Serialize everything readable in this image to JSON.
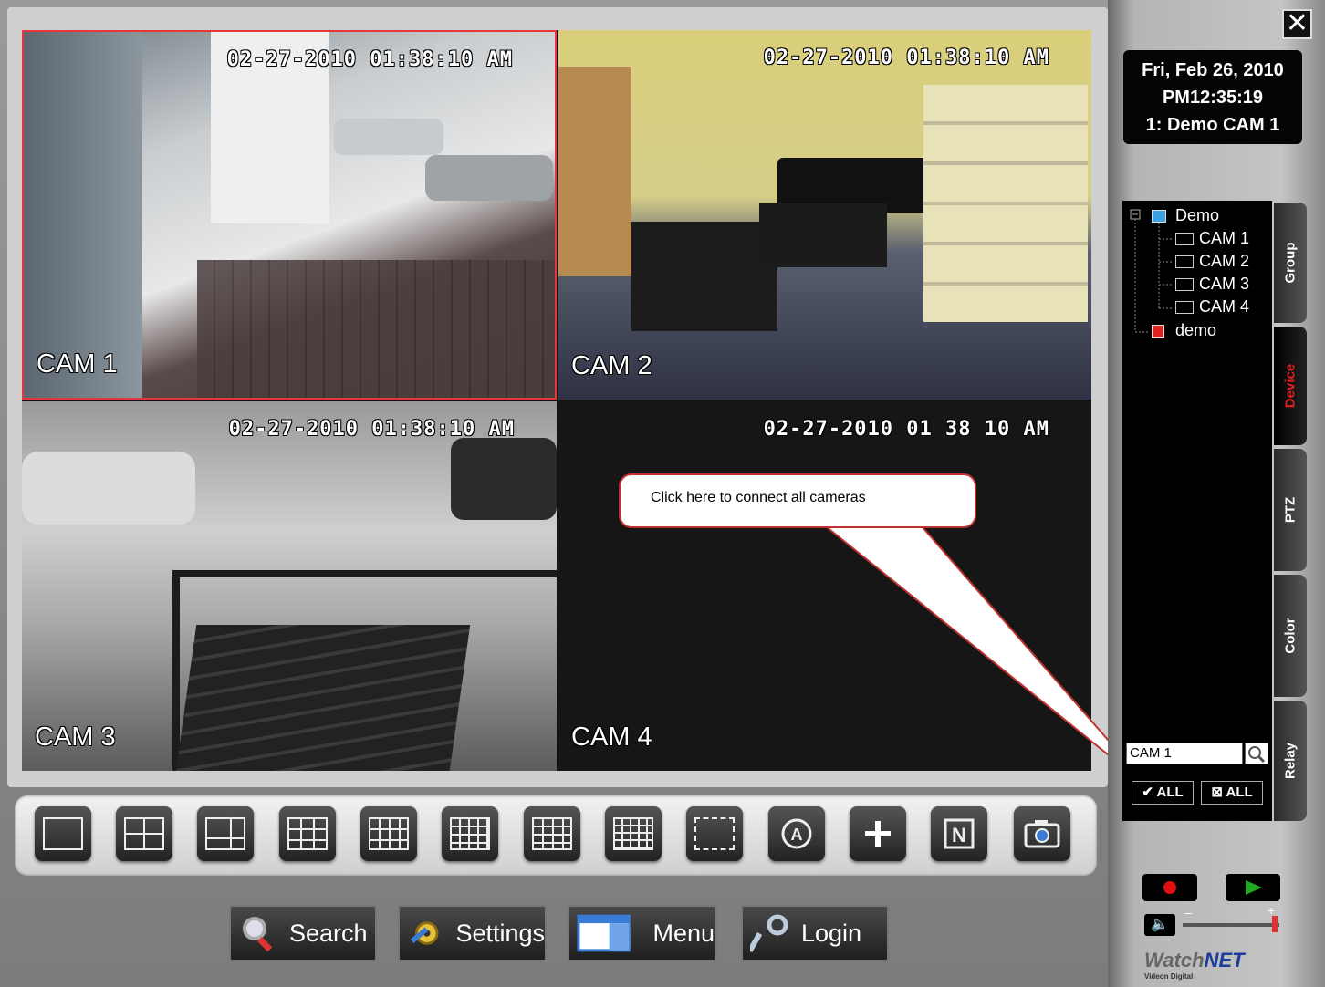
{
  "window": {
    "close_label": "✕"
  },
  "clock": {
    "date": "Fri, Feb 26, 2010",
    "time": "PM12:35:19",
    "camera": "1: Demo CAM 1"
  },
  "cameras": [
    {
      "label": "CAM 1",
      "timestamp": "02-27-2010 01:38:10 AM"
    },
    {
      "label": "CAM 2",
      "timestamp": "02-27-2010 01:38:10 AM"
    },
    {
      "label": "CAM 3",
      "timestamp": "02-27-2010 01:38:10 AM"
    },
    {
      "label": "CAM 4",
      "timestamp": "02-27-2010 01 38 10 AM"
    }
  ],
  "callout": {
    "text": "Click here to connect all cameras"
  },
  "tree": {
    "root": "Demo",
    "children": [
      "CAM 1",
      "CAM 2",
      "CAM 3",
      "CAM 4"
    ],
    "second_root": "demo"
  },
  "tabs": [
    "Group",
    "Device",
    "PTZ",
    "Color",
    "Relay"
  ],
  "active_tab": "Device",
  "search": {
    "value": "CAM 1"
  },
  "all_buttons": {
    "connect": "✔ ALL",
    "disconnect": "⊠ ALL"
  },
  "layout_buttons": [
    "1",
    "4",
    "6",
    "9",
    "10",
    "13",
    "16",
    "16b",
    "full",
    "auto",
    "add",
    "N",
    "snapshot"
  ],
  "bottom_buttons": {
    "search": "Search",
    "settings": "Settings",
    "menu": "Menu",
    "login": "Login"
  },
  "volume": {
    "minus": "–",
    "plus": "+",
    "level": 1.0
  },
  "logo": {
    "brand_a": "Watch",
    "brand_b": "NET",
    "sub": "Videon Digital"
  },
  "colors": {
    "selected_border": "#e23a3a",
    "active_tab_text": "#e02020",
    "record": "#e01010",
    "play": "#1faa1f"
  }
}
